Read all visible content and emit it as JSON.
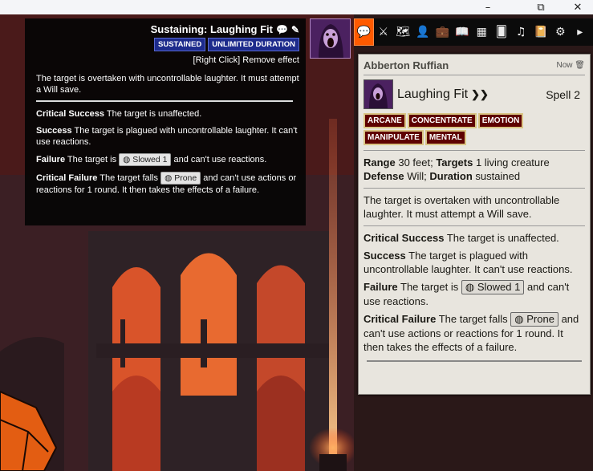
{
  "window_controls": {
    "minimize": "–",
    "maximize": "⧉",
    "close": "✕"
  },
  "effect_tooltip": {
    "title": "Sustaining: Laughing Fit",
    "tags": [
      "SUSTAINED",
      "UNLIMITED DURATION"
    ],
    "remove_hint": "[Right Click] Remove effect",
    "description": "The target is overtaken with uncontrollable laughter. It must attempt a Will save.",
    "critical_success_label": "Critical Success",
    "critical_success_text": " The target is unaffected.",
    "success_label": "Success",
    "success_text": " The target is plagued with uncontrollable laughter. It can't use reactions.",
    "failure_label": "Failure",
    "failure_pre": " The target is ",
    "failure_condition": "Slowed 1",
    "failure_post": " and can't use reactions.",
    "critical_failure_label": "Critical Failure",
    "critical_failure_pre": " The target falls ",
    "critical_failure_condition": "Prone",
    "critical_failure_post": " and can't use actions or reactions for 1 round. It then takes the effects of a failure."
  },
  "sidebar_tabs": [
    {
      "name": "chat",
      "icon": "💬"
    },
    {
      "name": "combat",
      "icon": "⚔"
    },
    {
      "name": "scenes",
      "icon": "🗺"
    },
    {
      "name": "actors",
      "icon": "👤"
    },
    {
      "name": "items",
      "icon": "💼"
    },
    {
      "name": "journal",
      "icon": "📖"
    },
    {
      "name": "tables",
      "icon": "▦"
    },
    {
      "name": "cards",
      "icon": "🂠"
    },
    {
      "name": "playlists",
      "icon": "♫"
    },
    {
      "name": "compendium",
      "icon": "📔"
    },
    {
      "name": "settings",
      "icon": "⚙"
    },
    {
      "name": "collapse",
      "icon": "▸"
    }
  ],
  "chat_message": {
    "speaker": "Abberton Ruffian",
    "timestamp": "Now",
    "item_name": "Laughing Fit",
    "actions_glyph": "❯❯",
    "level": "Spell 2",
    "traits": [
      "ARCANE",
      "CONCENTRATE",
      "EMOTION",
      "MANIPULATE",
      "MENTAL"
    ],
    "range_label": "Range",
    "range_value": " 30 feet; ",
    "targets_label": "Targets",
    "targets_value": " 1 living creature",
    "defense_label": "Defense",
    "defense_value": " Will; ",
    "duration_label": "Duration",
    "duration_value": " sustained",
    "description": "The target is overtaken with uncontrollable laughter. It must attempt a Will save.",
    "critical_success_label": "Critical Success",
    "critical_success_text": " The target is unaffected.",
    "success_label": "Success",
    "success_text": " The target is plagued with uncontrollable laughter. It can't use reactions.",
    "failure_label": "Failure",
    "failure_pre": " The target is ",
    "failure_condition": "Slowed 1",
    "failure_post": " and can't use reactions.",
    "critical_failure_label": "Critical Failure",
    "critical_failure_pre": " The target falls ",
    "critical_failure_condition": "Prone",
    "critical_failure_post": " and can't use actions or reactions for 1 round. It then takes the effects of a failure."
  }
}
